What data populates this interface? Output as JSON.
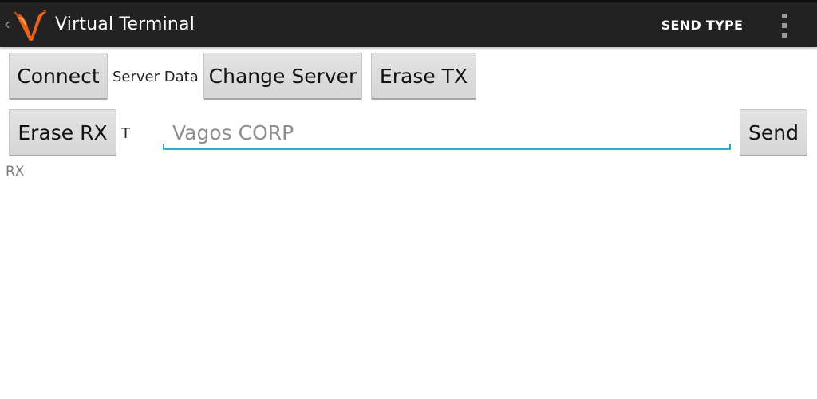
{
  "action_bar": {
    "back_glyph": "‹",
    "title": "Virtual Terminal",
    "send_type_label": "SEND TYPE",
    "logo_icon": "vagos-v-logo-icon",
    "overflow_icon": "overflow-menu-icon",
    "background": "#222222",
    "logo_color": "#e8631a"
  },
  "row1": {
    "connect_label": "Connect",
    "server_data_label": "Server Data",
    "change_server_label": "Change Server",
    "erase_tx_label": "Erase TX"
  },
  "row2": {
    "erase_rx_label": "Erase RX",
    "tx_label": "T",
    "message_value": "",
    "message_placeholder": "Vagos CORP",
    "send_label": "Send",
    "accent": "#33a7d8"
  },
  "rx_label": "RX"
}
